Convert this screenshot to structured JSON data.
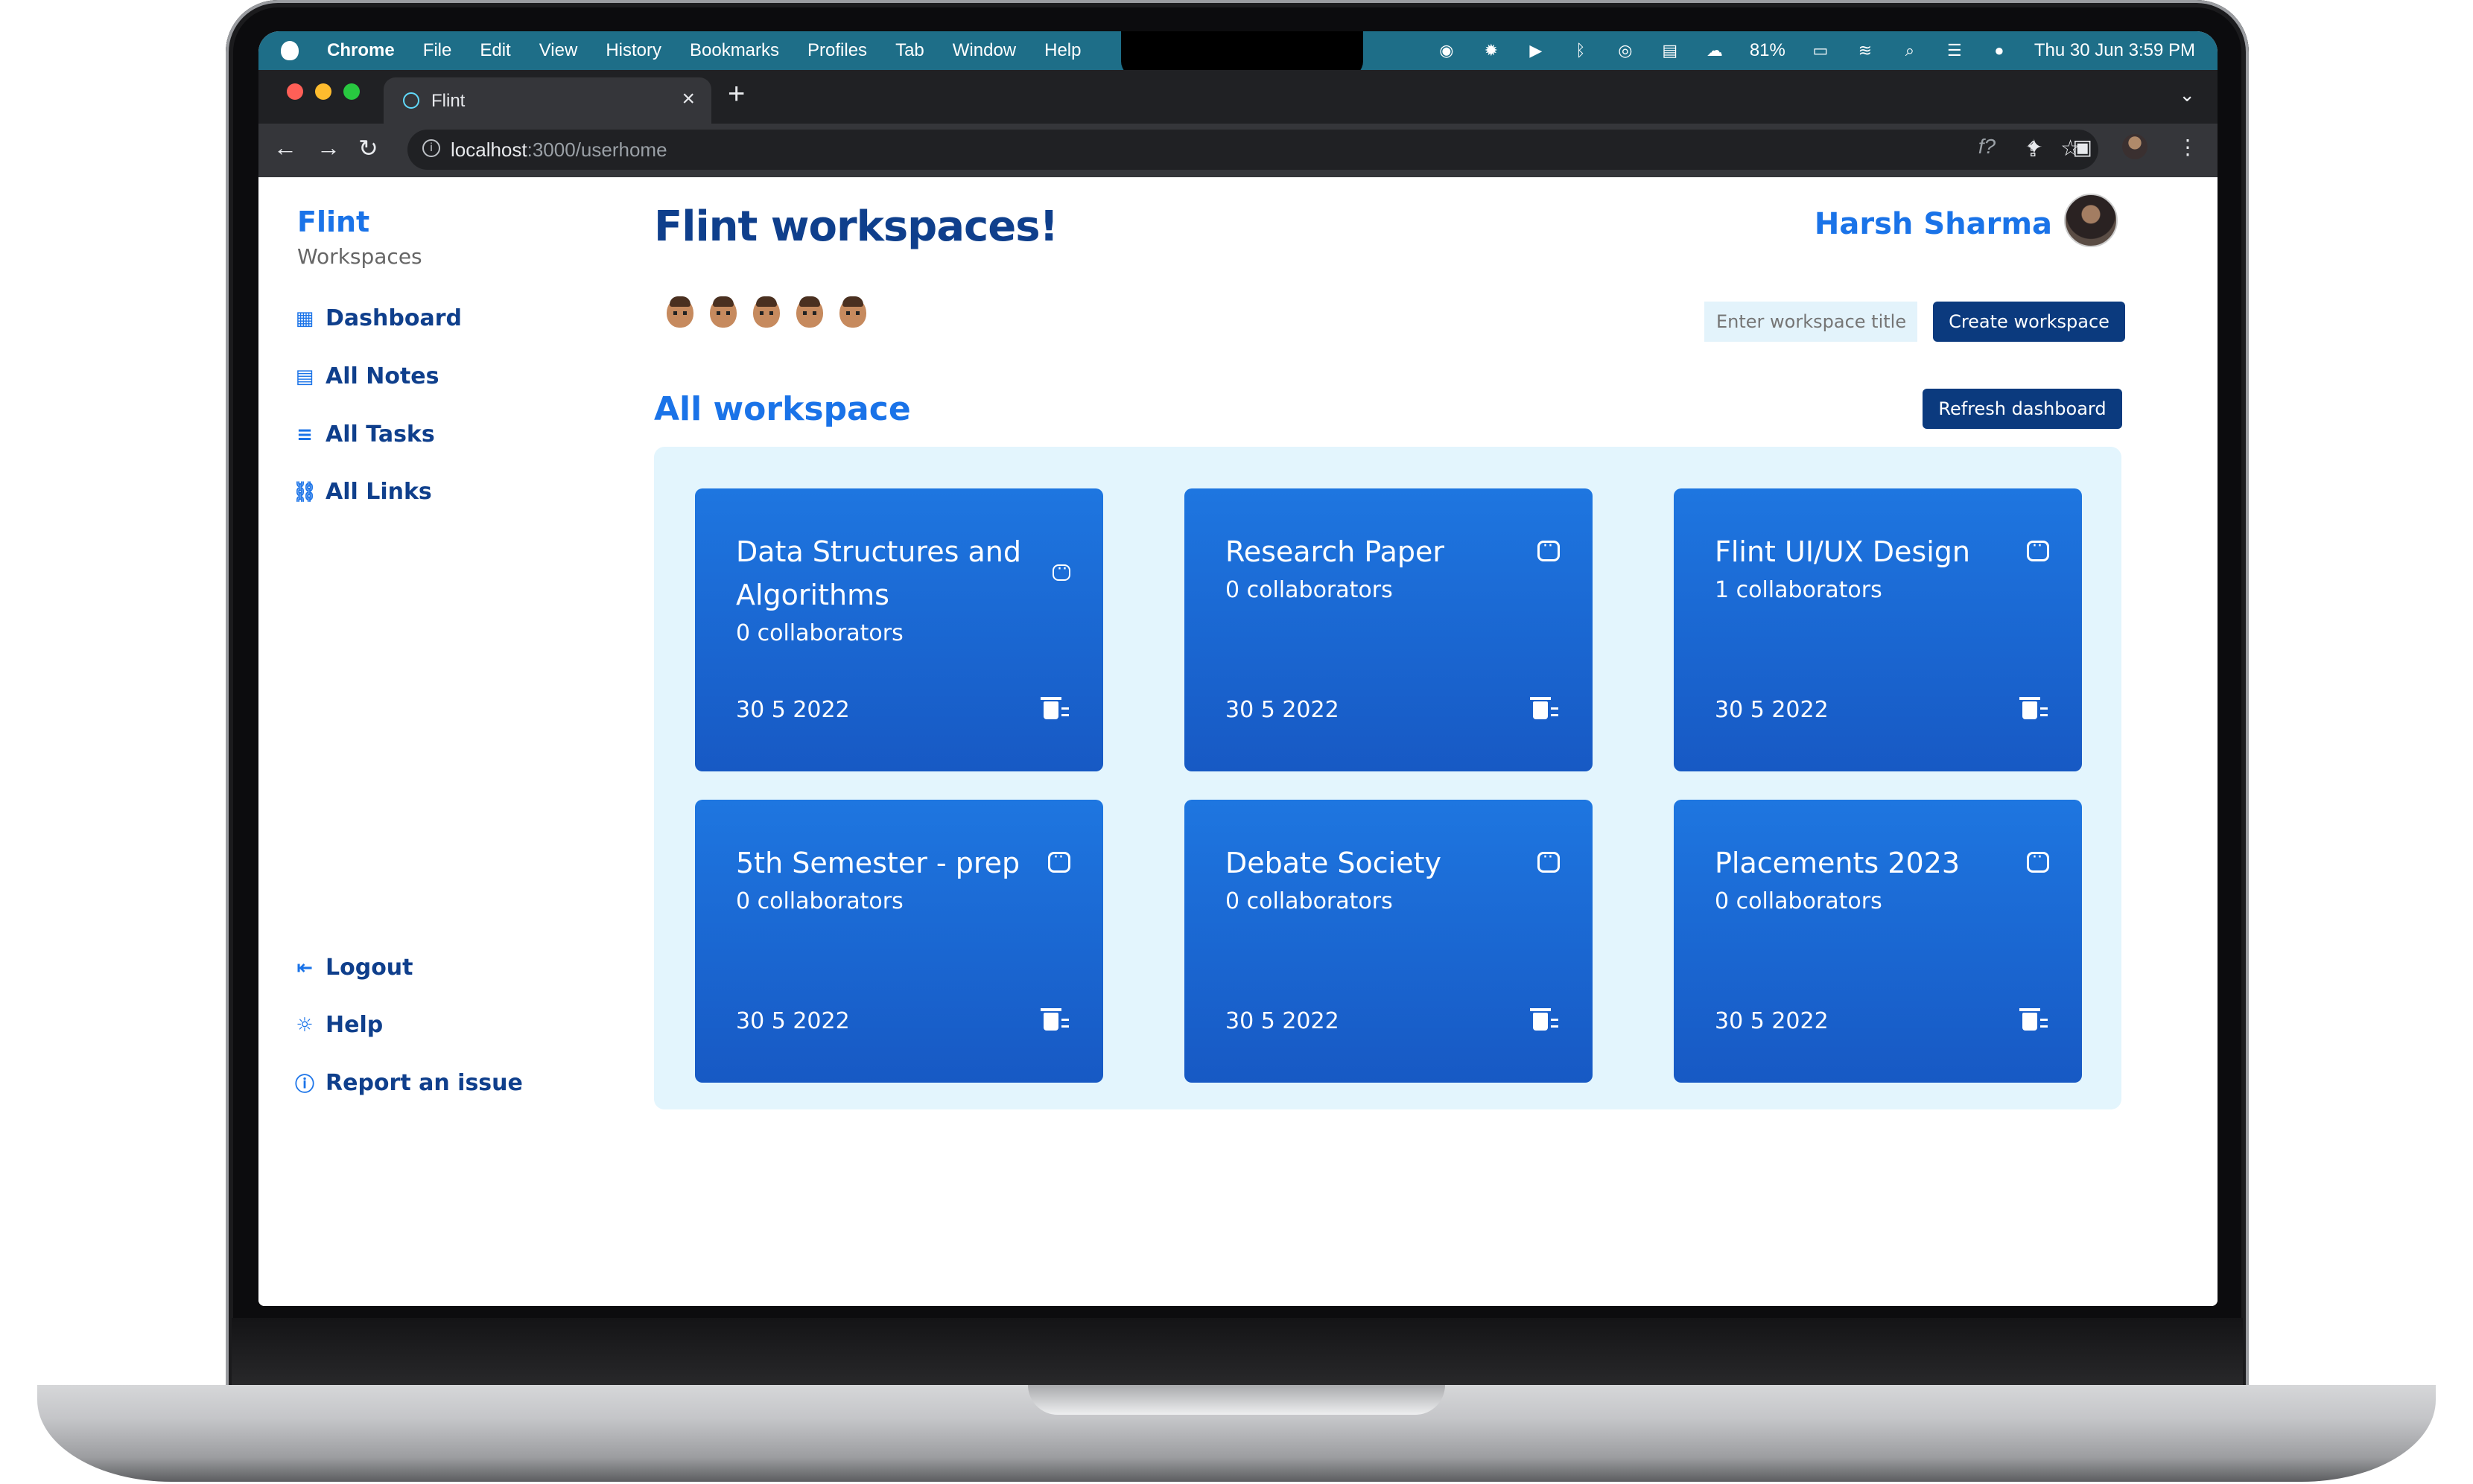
{
  "menubar": {
    "app": "Chrome",
    "items": [
      "File",
      "Edit",
      "View",
      "History",
      "Bookmarks",
      "Profiles",
      "Tab",
      "Window",
      "Help"
    ],
    "battery": "81%",
    "datetime": "Thu 30 Jun  3:59 PM"
  },
  "browser": {
    "tab_title": "Flint",
    "url_host": "localhost",
    "url_path": ":3000/userhome"
  },
  "sidebar": {
    "brand": "Flint",
    "brand_sub": "Workspaces",
    "items": [
      {
        "label": "Dashboard",
        "icon": "dashboard-icon"
      },
      {
        "label": "All Notes",
        "icon": "notes-icon"
      },
      {
        "label": "All Tasks",
        "icon": "tasks-icon"
      },
      {
        "label": "All Links",
        "icon": "link-icon"
      }
    ],
    "bottom_items": [
      {
        "label": "Logout",
        "icon": "logout-icon"
      },
      {
        "label": "Help",
        "icon": "help-icon"
      },
      {
        "label": "Report an issue",
        "icon": "report-icon"
      }
    ]
  },
  "header": {
    "greeting": "Flint workspaces!",
    "user_name": "Harsh Sharma"
  },
  "create": {
    "placeholder": "Enter workspace title",
    "button": "Create workspace"
  },
  "workspaces": {
    "section_title": "All workspace",
    "refresh_button": "Refresh dashboard",
    "cards": [
      {
        "title": "Data Structures and Algorithms",
        "collaborators": "0 collaborators",
        "date": "30 5 2022"
      },
      {
        "title": "Research Paper",
        "collaborators": "0 collaborators",
        "date": "30 5 2022"
      },
      {
        "title": "Flint UI/UX Design",
        "collaborators": "1 collaborators",
        "date": "30 5 2022"
      },
      {
        "title": "5th Semester - prep",
        "collaborators": "0 collaborators",
        "date": "30 5 2022"
      },
      {
        "title": "Debate Society",
        "collaborators": "0 collaborators",
        "date": "30 5 2022"
      },
      {
        "title": "Placements 2023",
        "collaborators": "0 collaborators",
        "date": "30 5 2022"
      }
    ]
  },
  "colors": {
    "primary": "#1a73e8",
    "navy": "#0b3a7e",
    "panel": "#e3f5fd",
    "menubar": "#1e6e88"
  }
}
